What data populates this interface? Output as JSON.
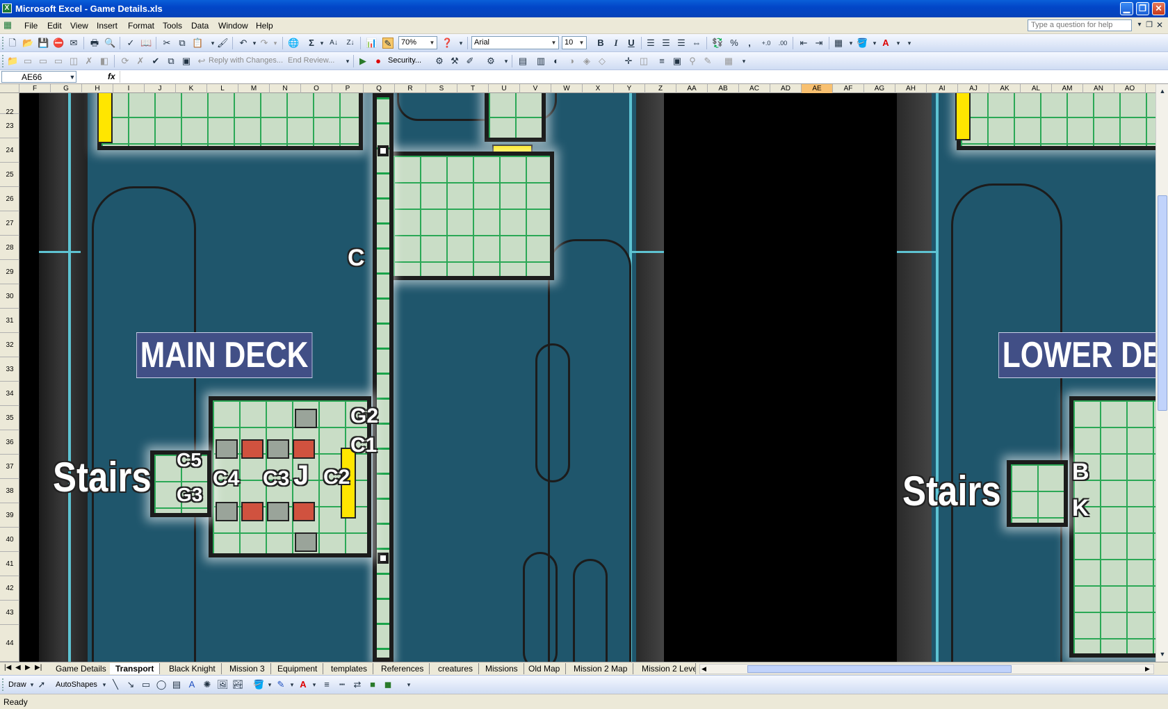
{
  "window": {
    "title": "Microsoft Excel - Game Details.xls",
    "app_icon": "X"
  },
  "menus": [
    "File",
    "Edit",
    "View",
    "Insert",
    "Format",
    "Tools",
    "Data",
    "Window",
    "Help"
  ],
  "help_placeholder": "Type a question for help",
  "toolbar": {
    "zoom": "70%",
    "font": "Arial",
    "font_size": "10",
    "bold": "B",
    "italic": "I",
    "underline": "U",
    "percent": "%",
    "comma": ",",
    "sigma": "Σ"
  },
  "reviewing": {
    "reply_with_changes": "Reply with Changes...",
    "end_review": "End Review...",
    "security": "Security..."
  },
  "formula_bar": {
    "name_box": "AE66",
    "fx": "fx",
    "value": ""
  },
  "columns": [
    "F",
    "G",
    "H",
    "I",
    "J",
    "K",
    "L",
    "M",
    "N",
    "O",
    "P",
    "Q",
    "R",
    "S",
    "T",
    "U",
    "V",
    "W",
    "X",
    "Y",
    "Z",
    "AA",
    "AB",
    "AC",
    "AD",
    "AE",
    "AF",
    "AG",
    "AH",
    "AI",
    "AJ",
    "AK",
    "AL",
    "AM",
    "AN",
    "AO"
  ],
  "selected_column": "AE",
  "rows": [
    "22",
    "23",
    "24",
    "25",
    "26",
    "27",
    "28",
    "29",
    "30",
    "31",
    "32",
    "33",
    "34",
    "35",
    "36",
    "37",
    "38",
    "39",
    "40",
    "41",
    "42",
    "43",
    "44"
  ],
  "map": {
    "main_deck": "MAIN DECK",
    "lower_deck": "LOWER DECK",
    "stairs_left": "Stairs",
    "stairs_right": "Stairs",
    "c": "C",
    "g2": "G2",
    "c1": "C1",
    "c2": "C2",
    "c3": "C3",
    "c4": "C4",
    "c5": "C5",
    "g3": "G3",
    "j": "J",
    "b": "B",
    "k": "K"
  },
  "sheet_tabs": [
    "Game Details",
    "Transport",
    "Black Knight",
    "Mission 3",
    "Equipment",
    "templates",
    "References",
    "creatures",
    "Missions",
    "Old Map",
    "Mission 2 Map",
    "Mission 2 Leve"
  ],
  "active_tab": "Transport",
  "draw_toolbar": {
    "draw": "Draw",
    "autoshapes": "AutoShapes"
  },
  "status": "Ready"
}
